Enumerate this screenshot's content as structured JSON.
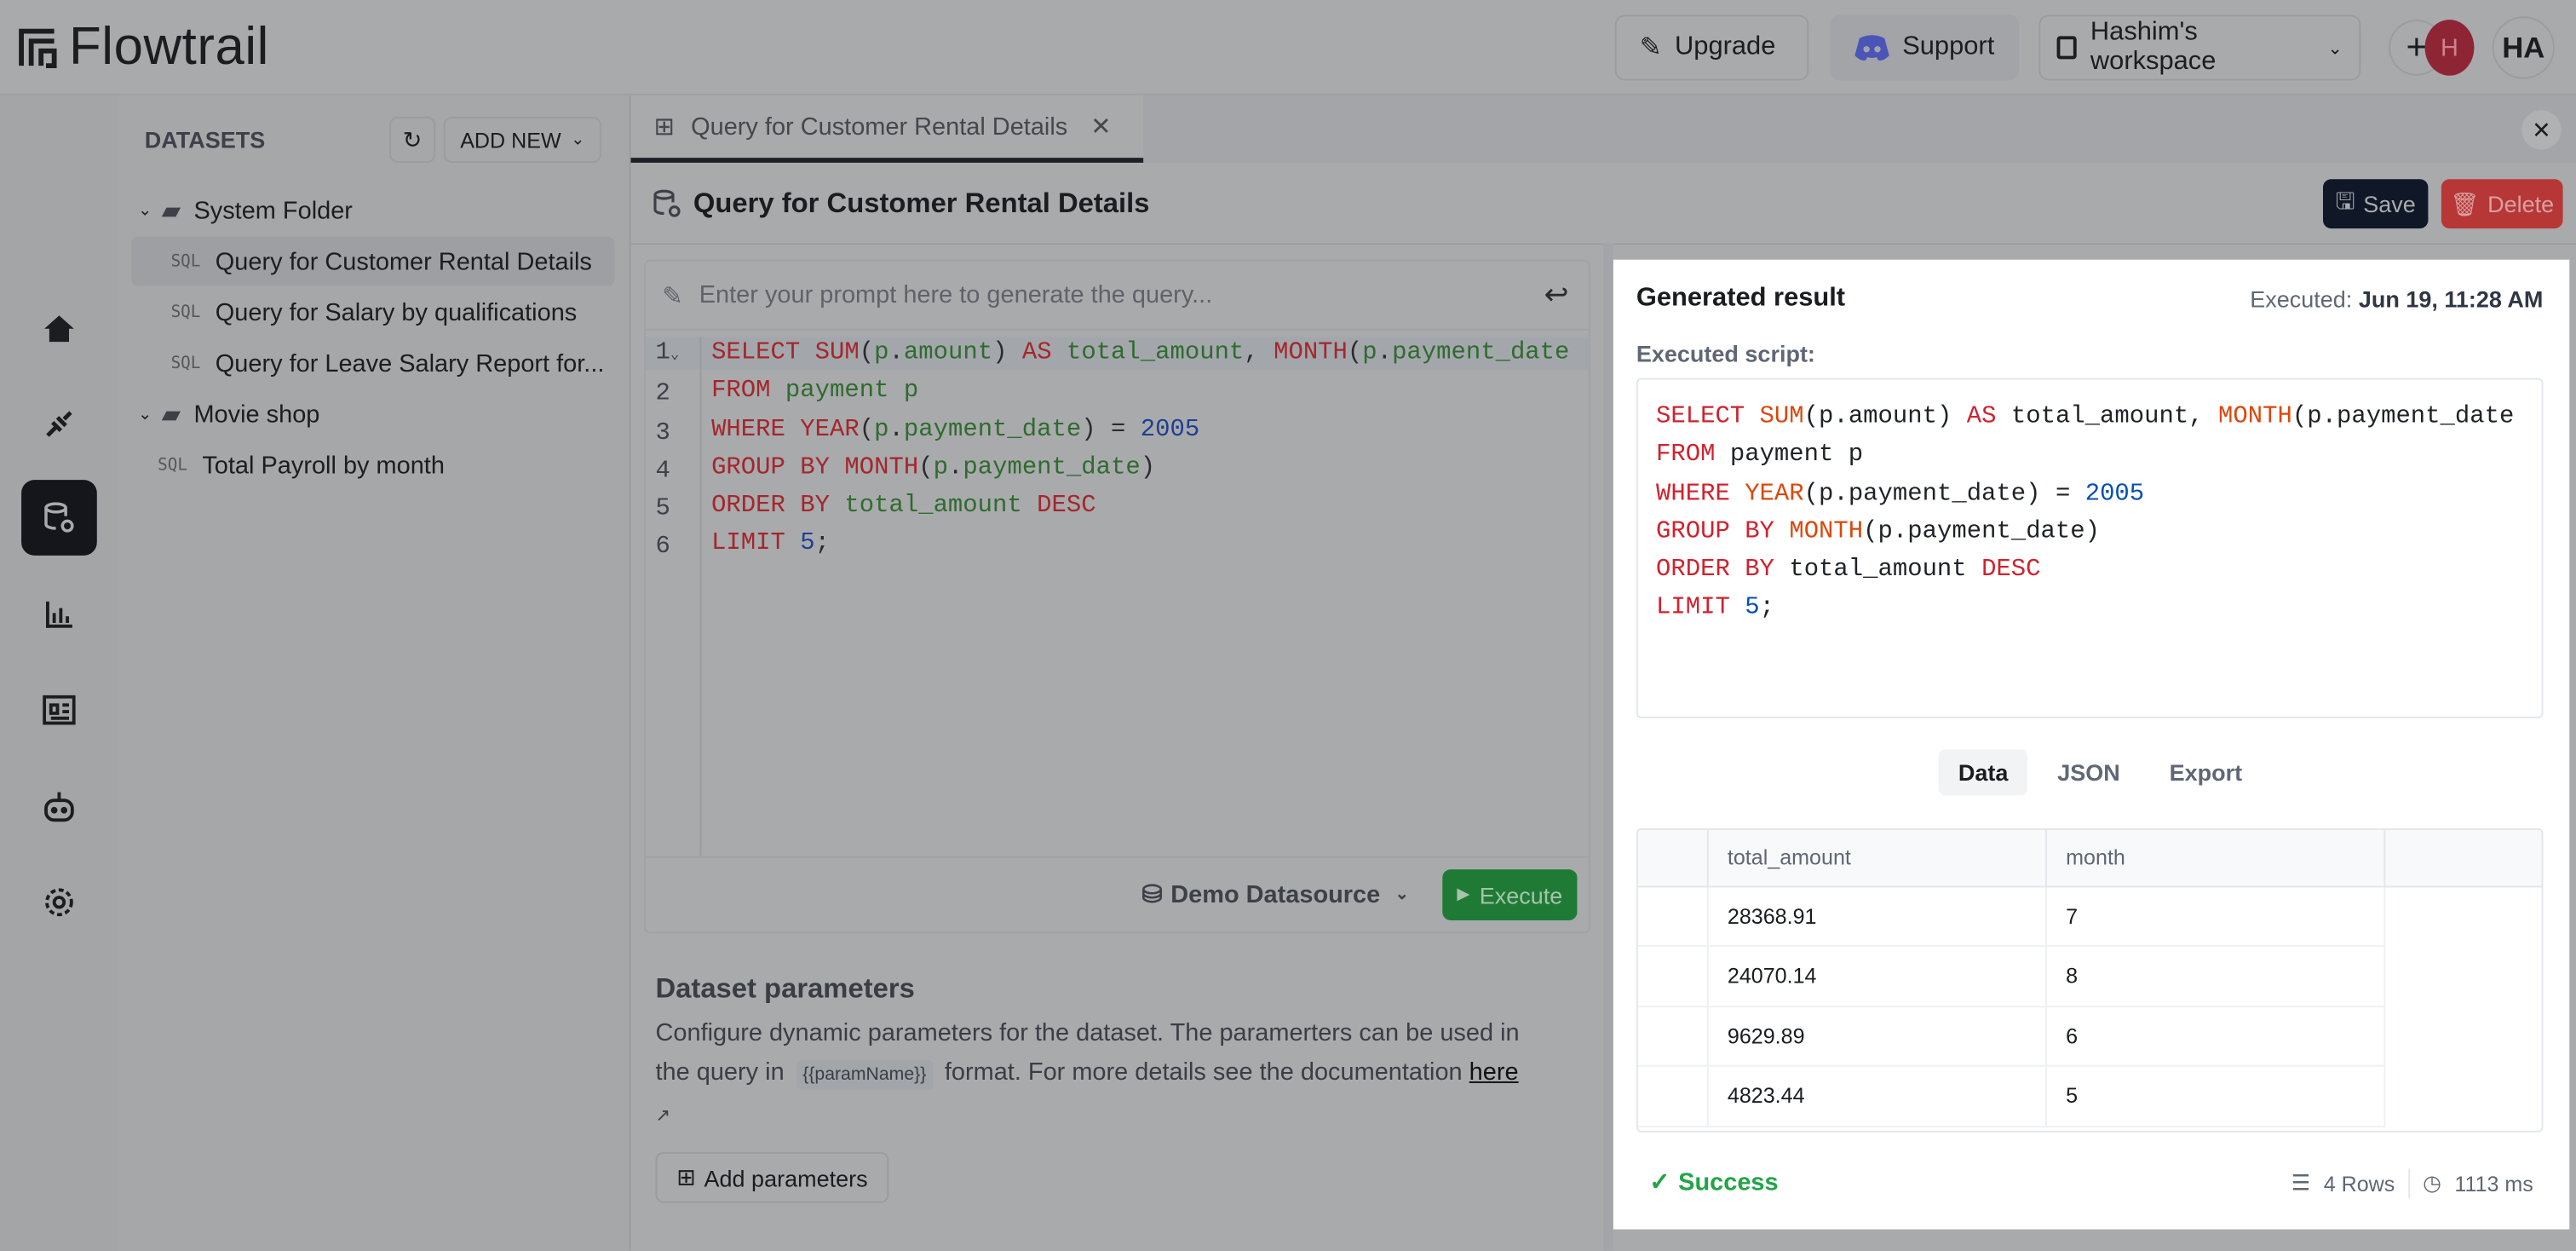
{
  "app": {
    "name": "Flowtrail"
  },
  "header": {
    "upgrade": "Upgrade",
    "support": "Support",
    "workspace": "Hashim's workspace",
    "avatar_small": "H",
    "avatar": "HA"
  },
  "rail": {
    "items": [
      "home-icon",
      "plug-icon",
      "dataset-icon",
      "chart-icon",
      "dashboard-icon",
      "bot-icon",
      "gear-icon"
    ],
    "active": 2
  },
  "sidebar": {
    "title": "DATASETS",
    "add_new": "ADD NEW",
    "folders": [
      {
        "name": "System Folder",
        "items": [
          "Query for Customer Rental Details",
          "Query for Salary by qualifications",
          "Query for Leave Salary Report for..."
        ]
      },
      {
        "name": "Movie shop",
        "items": [
          "Total Payroll by month"
        ]
      }
    ],
    "sql_tag": "SQL",
    "selected": "Query for Customer Rental Details"
  },
  "tab": {
    "label": "Query for Customer Rental Details"
  },
  "page": {
    "title": "Query for Customer Rental Details",
    "save": "Save",
    "delete": "Delete"
  },
  "editor": {
    "prompt_placeholder": "Enter your prompt here to generate the query...",
    "lines": [
      "SELECT SUM(p.amount) AS total_amount, MONTH(p.payment_date",
      "FROM payment p",
      "WHERE YEAR(p.payment_date) = 2005",
      "GROUP BY MONTH(p.payment_date)",
      "ORDER BY total_amount DESC",
      "LIMIT 5;"
    ],
    "datasource": "Demo Datasource",
    "execute": "Execute"
  },
  "params": {
    "title": "Dataset parameters",
    "desc1": "Configure dynamic parameters for the dataset. The paramerters can be used in",
    "desc2a": "the query in",
    "chip": "{{paramName}}",
    "desc2b": "format. For more details see the documentation",
    "link": "here",
    "add": "Add parameters"
  },
  "result": {
    "title": "Generated result",
    "executed_label": "Executed:",
    "executed_at": "Jun 19, 11:28 AM",
    "script_label": "Executed script:",
    "script": [
      "SELECT SUM(p.amount) AS total_amount, MONTH(p.payment_date",
      "FROM payment p",
      "WHERE YEAR(p.payment_date) = 2005",
      "GROUP BY MONTH(p.payment_date)",
      "ORDER BY total_amount DESC",
      "LIMIT 5;"
    ],
    "tabs": [
      "Data",
      "JSON",
      "Export"
    ],
    "active_tab": "Data",
    "columns": [
      "total_amount",
      "month"
    ],
    "rows": [
      [
        "28368.91",
        "7"
      ],
      [
        "24070.14",
        "8"
      ],
      [
        "9629.89",
        "6"
      ],
      [
        "4823.44",
        "5"
      ]
    ],
    "status": "Success",
    "rows_count": "4 Rows",
    "duration": "1113 ms",
    "colors": {
      "success": "#22a447",
      "execute": "#1f7a35",
      "delete": "#c73a3a",
      "save": "#101828"
    }
  }
}
